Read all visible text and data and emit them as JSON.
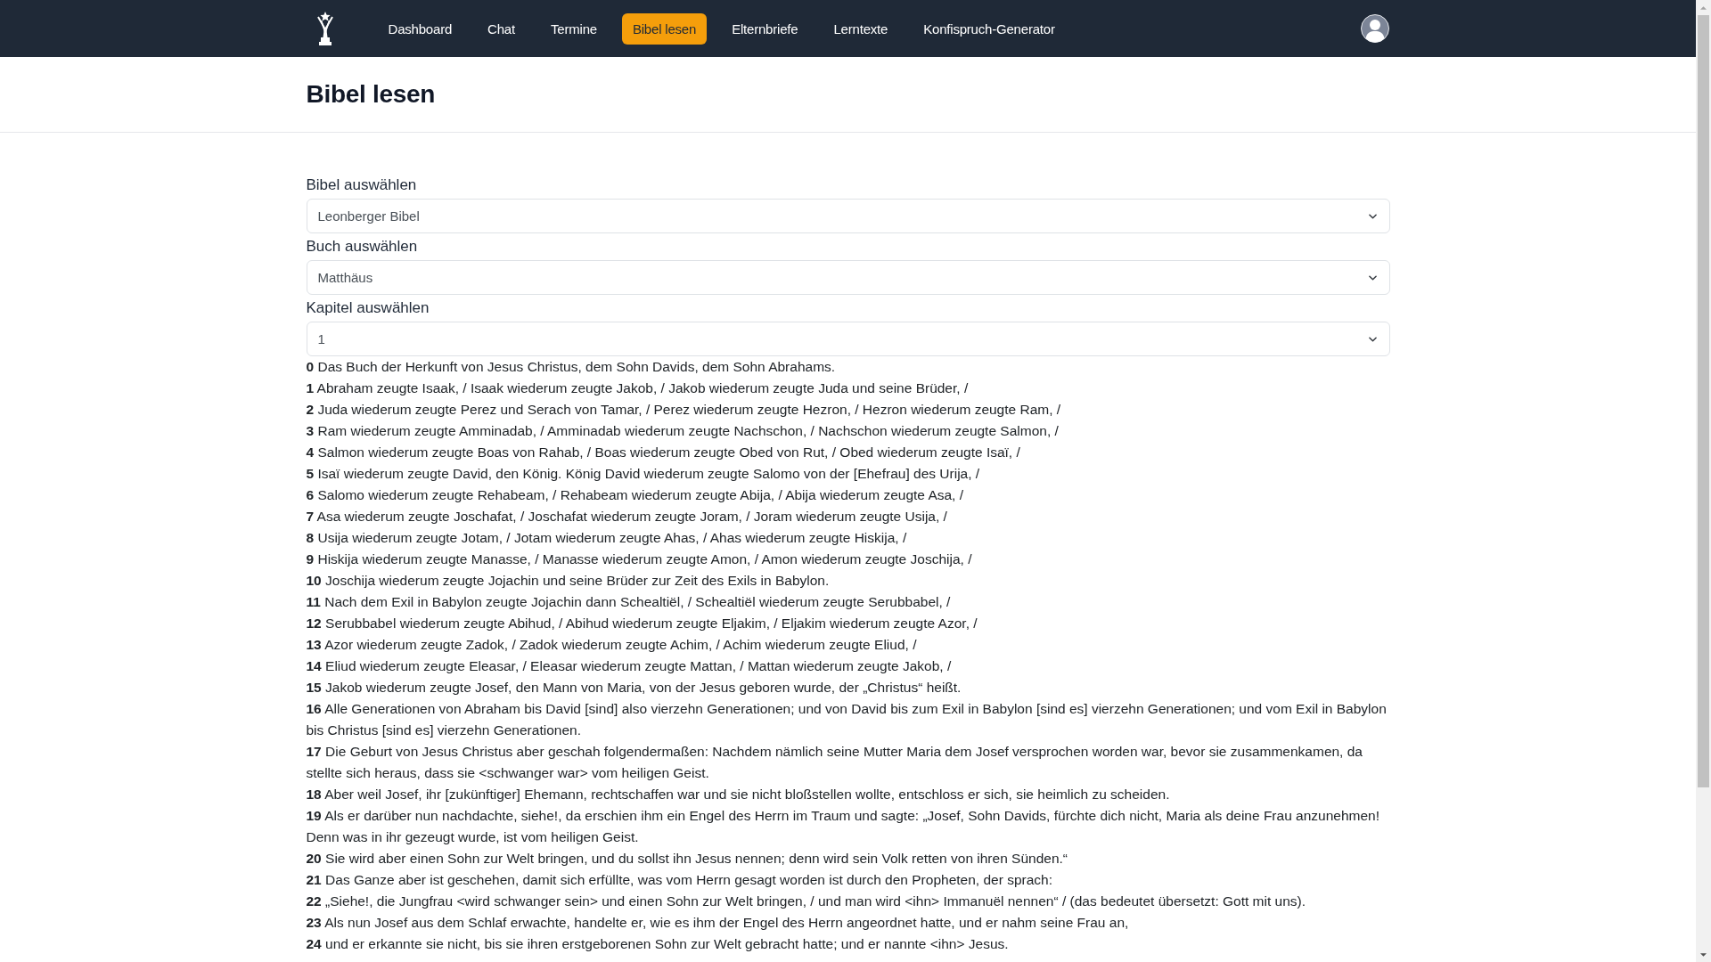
{
  "navbar": {
    "items": [
      {
        "label": "Dashboard",
        "selected": false
      },
      {
        "label": "Chat",
        "selected": false
      },
      {
        "label": "Termine",
        "selected": false
      },
      {
        "label": "Bibel lesen",
        "selected": true
      },
      {
        "label": "Elternbriefe",
        "selected": false
      },
      {
        "label": "Lerntexte",
        "selected": false
      },
      {
        "label": "Konfispruch-Generator",
        "selected": false
      }
    ]
  },
  "page_title": "Bibel lesen",
  "selectors": [
    {
      "label": "Bibel auswählen",
      "value": "Leonberger Bibel"
    },
    {
      "label": "Buch auswählen",
      "value": "Matthäus"
    },
    {
      "label": "Kapitel auswählen",
      "value": "1"
    }
  ],
  "verses": [
    {
      "number": "0",
      "text": "Das Buch der Herkunft von Jesus Christus, dem Sohn Davids, dem Sohn Abrahams."
    },
    {
      "number": "1",
      "text": "Abraham zeugte Isaak, / Isaak wiederum zeugte Jakob, / Jakob wiederum zeugte Juda und seine Brüder, /"
    },
    {
      "number": "2",
      "text": "Juda wiederum zeugte Perez und Serach von Tamar, / Perez wiederum zeugte Hezron, / Hezron wiederum zeugte Ram, /"
    },
    {
      "number": "3",
      "text": "Ram wiederum zeugte Amminadab, / Amminadab wiederum zeugte Nachschon, / Nachschon wiederum zeugte Salmon, /"
    },
    {
      "number": "4",
      "text": "Salmon wiederum zeugte Boas von Rahab, / Boas wiederum zeugte Obed von Rut, / Obed wiederum zeugte Isaï, /"
    },
    {
      "number": "5",
      "text": "Isaï wiederum zeugte David, den König. König David wiederum zeugte Salomo von der [Ehefrau] des Urija, /"
    },
    {
      "number": "6",
      "text": "Salomo wiederum zeugte Rehabeam, / Rehabeam wiederum zeugte Abija, / Abija wiederum zeugte Asa, /"
    },
    {
      "number": "7",
      "text": "Asa wiederum zeugte Joschafat, / Joschafat wiederum zeugte Joram, / Joram wiederum zeugte Usija, /"
    },
    {
      "number": "8",
      "text": "Usija wiederum zeugte Jotam, / Jotam wiederum zeugte Ahas, / Ahas wiederum zeugte Hiskija, /"
    },
    {
      "number": "9",
      "text": "Hiskija wiederum zeugte Manasse, / Manasse wiederum zeugte Amon, / Amon wiederum zeugte Joschija, /"
    },
    {
      "number": "10",
      "text": "Joschija wiederum zeugte Jojachin und seine Brüder zur Zeit des Exils in Babylon."
    },
    {
      "number": "11",
      "text": "Nach dem Exil in Babylon zeugte Jojachin dann Schealtiël, / Schealtiël wiederum zeugte Serubbabel, /"
    },
    {
      "number": "12",
      "text": "Serubbabel wiederum zeugte Abihud, / Abihud wiederum zeugte Eljakim, / Eljakim wiederum zeugte Azor, /"
    },
    {
      "number": "13",
      "text": "Azor wiederum zeugte Zadok, / Zadok wiederum zeugte Achim, / Achim wiederum zeugte Eliud, /"
    },
    {
      "number": "14",
      "text": "Eliud wiederum zeugte Eleasar, / Eleasar wiederum zeugte Mattan, / Mattan wiederum zeugte Jakob, /"
    },
    {
      "number": "15",
      "text": "Jakob wiederum zeugte Josef, den Mann von Maria, von der Jesus geboren wurde, der „Christus“ heißt."
    },
    {
      "number": "16",
      "text": "Alle Generationen von Abraham bis David [sind] also vierzehn Generationen; und von David bis zum Exil in Babylon [sind es] vierzehn Generationen; und vom Exil in Babylon bis Christus [sind es] vierzehn Generationen."
    },
    {
      "number": "17",
      "text": "Die Geburt von Jesus Christus aber geschah folgendermaßen: Nachdem nämlich seine Mutter Maria dem Josef versprochen worden war, bevor sie zusammenkamen, da stellte sich heraus, dass sie <schwanger war> vom heiligen Geist."
    },
    {
      "number": "18",
      "text": "Aber weil Josef, ihr [zukünftiger] Ehemann, rechtschaffen war und sie nicht bloßstellen wollte, entschloss er sich, sie heimlich zu scheiden."
    },
    {
      "number": "19",
      "text": "Als er darüber nun nachdachte, siehe!, da erschien ihm ein Engel des Herrn im Traum und sagte: „Josef, Sohn Davids, fürchte dich nicht, Maria als deine Frau anzunehmen! Denn was in ihr gezeugt wurde, ist vom heiligen Geist."
    },
    {
      "number": "20",
      "text": "Sie wird aber einen Sohn zur Welt bringen, und du sollst ihn Jesus nennen; denn wird sein Volk retten von ihren Sünden.“"
    },
    {
      "number": "21",
      "text": "Das Ganze aber ist geschehen, damit sich erfüllte, was vom Herrn gesagt worden ist durch den Propheten, der sprach:"
    },
    {
      "number": "22",
      "text": "„Siehe!, die Jungfrau <wird schwanger sein> und einen Sohn zur Welt bringen, / und man wird <ihn> Immanuël nennen“ / (das bedeutet übersetzt: Gott mit uns)."
    },
    {
      "number": "23",
      "text": "Als nun Josef aus dem Schlaf erwachte, handelte er, wie es ihm der Engel des Herrn angeordnet hatte, und er nahm seine Frau an,"
    },
    {
      "number": "24",
      "text": "und er erkannte sie nicht, bis sie ihren erstgeborenen Sohn zur Welt gebracht hatte; und er nannte <ihn> Jesus."
    }
  ]
}
